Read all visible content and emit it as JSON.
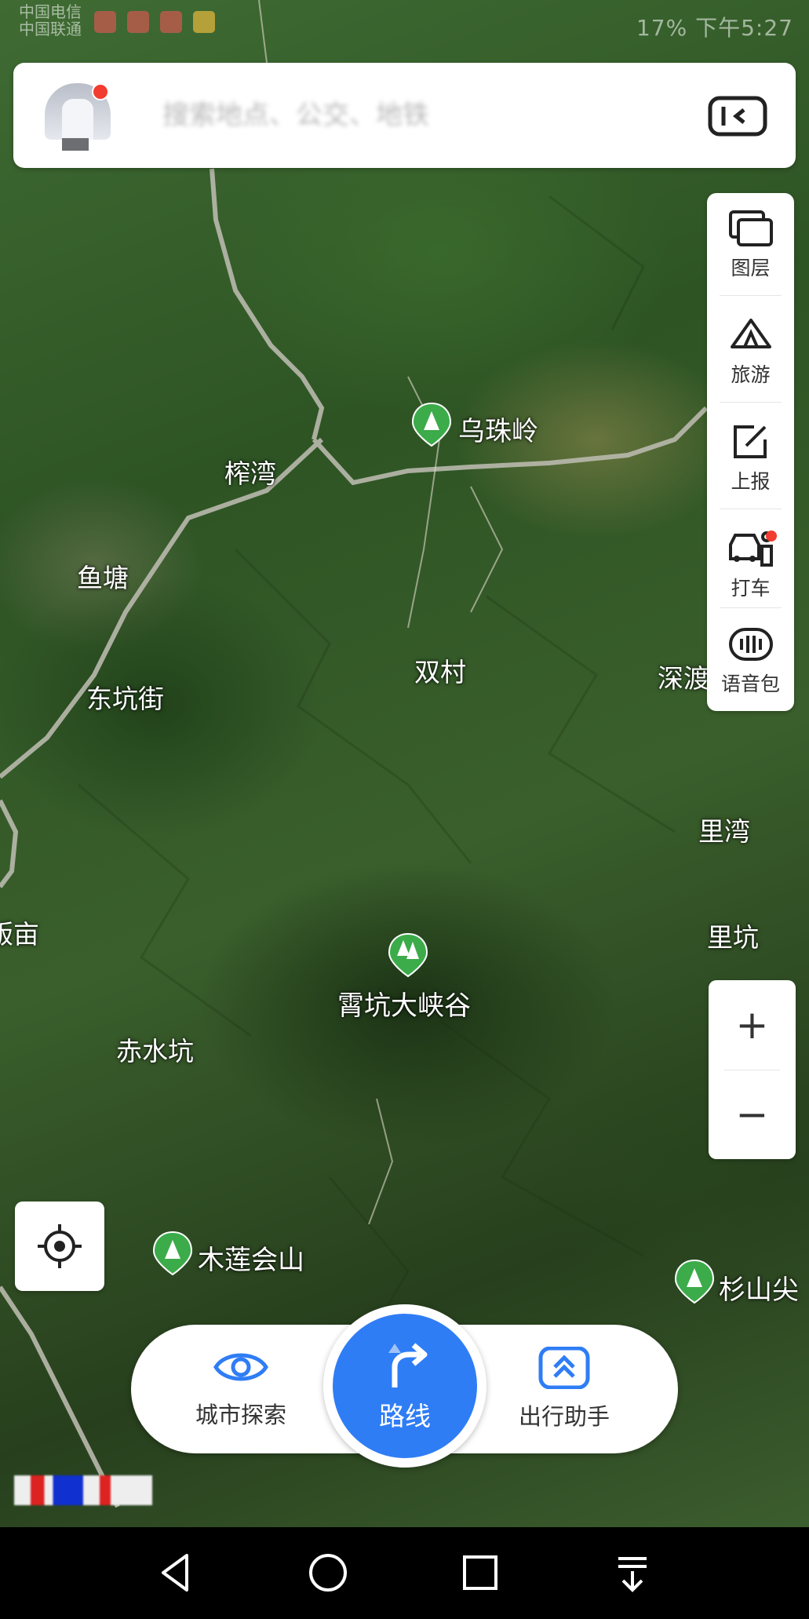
{
  "status_bar": {
    "carrier_line1": "中国电信",
    "carrier_line2": "中国联通",
    "right_text": "17%  下午5:27"
  },
  "search": {
    "placeholder": "搜索地点、公交、地铁"
  },
  "toolbox": {
    "items": [
      {
        "label": "图层",
        "icon": "layers-icon"
      },
      {
        "label": "旅游",
        "icon": "travel-icon"
      },
      {
        "label": "上报",
        "icon": "report-icon"
      },
      {
        "label": "打车",
        "icon": "taxi-icon"
      },
      {
        "label": "语音包",
        "icon": "voice-pack-icon"
      }
    ]
  },
  "map": {
    "place_labels": [
      {
        "text": "榨湾"
      },
      {
        "text": "鱼塘"
      },
      {
        "text": "东坑街"
      },
      {
        "text": "双村"
      },
      {
        "text": "深渡"
      },
      {
        "text": "里湾"
      },
      {
        "text": "里坑"
      },
      {
        "text": "赤水坑"
      },
      {
        "text": "畈亩"
      }
    ],
    "pois": [
      {
        "name": "乌珠岭"
      },
      {
        "name": "霄坑大峡谷"
      },
      {
        "name": "木莲会山"
      },
      {
        "name": "杉山尖"
      }
    ]
  },
  "zoom": {
    "in": "+",
    "out": "−"
  },
  "bottom": {
    "explore_label": "城市探索",
    "route_label": "路线",
    "assistant_label": "出行助手"
  },
  "colors": {
    "accent": "#2f7df5",
    "poi_green": "#3cab4a",
    "badge_red": "#f23c2f"
  }
}
